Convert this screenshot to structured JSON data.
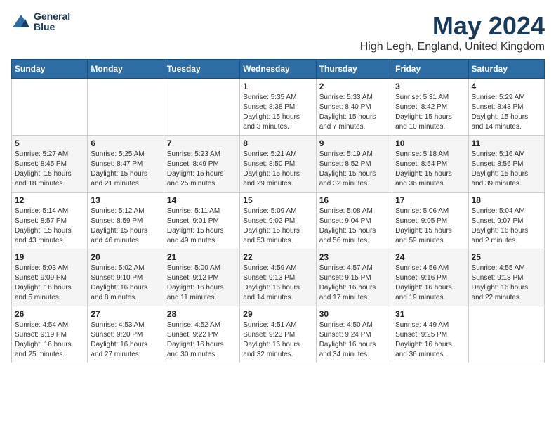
{
  "logo": {
    "line1": "General",
    "line2": "Blue"
  },
  "title": "May 2024",
  "subtitle": "High Legh, England, United Kingdom",
  "weekdays": [
    "Sunday",
    "Monday",
    "Tuesday",
    "Wednesday",
    "Thursday",
    "Friday",
    "Saturday"
  ],
  "weeks": [
    [
      {
        "day": "",
        "info": ""
      },
      {
        "day": "",
        "info": ""
      },
      {
        "day": "",
        "info": ""
      },
      {
        "day": "1",
        "info": "Sunrise: 5:35 AM\nSunset: 8:38 PM\nDaylight: 15 hours\nand 3 minutes."
      },
      {
        "day": "2",
        "info": "Sunrise: 5:33 AM\nSunset: 8:40 PM\nDaylight: 15 hours\nand 7 minutes."
      },
      {
        "day": "3",
        "info": "Sunrise: 5:31 AM\nSunset: 8:42 PM\nDaylight: 15 hours\nand 10 minutes."
      },
      {
        "day": "4",
        "info": "Sunrise: 5:29 AM\nSunset: 8:43 PM\nDaylight: 15 hours\nand 14 minutes."
      }
    ],
    [
      {
        "day": "5",
        "info": "Sunrise: 5:27 AM\nSunset: 8:45 PM\nDaylight: 15 hours\nand 18 minutes."
      },
      {
        "day": "6",
        "info": "Sunrise: 5:25 AM\nSunset: 8:47 PM\nDaylight: 15 hours\nand 21 minutes."
      },
      {
        "day": "7",
        "info": "Sunrise: 5:23 AM\nSunset: 8:49 PM\nDaylight: 15 hours\nand 25 minutes."
      },
      {
        "day": "8",
        "info": "Sunrise: 5:21 AM\nSunset: 8:50 PM\nDaylight: 15 hours\nand 29 minutes."
      },
      {
        "day": "9",
        "info": "Sunrise: 5:19 AM\nSunset: 8:52 PM\nDaylight: 15 hours\nand 32 minutes."
      },
      {
        "day": "10",
        "info": "Sunrise: 5:18 AM\nSunset: 8:54 PM\nDaylight: 15 hours\nand 36 minutes."
      },
      {
        "day": "11",
        "info": "Sunrise: 5:16 AM\nSunset: 8:56 PM\nDaylight: 15 hours\nand 39 minutes."
      }
    ],
    [
      {
        "day": "12",
        "info": "Sunrise: 5:14 AM\nSunset: 8:57 PM\nDaylight: 15 hours\nand 43 minutes."
      },
      {
        "day": "13",
        "info": "Sunrise: 5:12 AM\nSunset: 8:59 PM\nDaylight: 15 hours\nand 46 minutes."
      },
      {
        "day": "14",
        "info": "Sunrise: 5:11 AM\nSunset: 9:01 PM\nDaylight: 15 hours\nand 49 minutes."
      },
      {
        "day": "15",
        "info": "Sunrise: 5:09 AM\nSunset: 9:02 PM\nDaylight: 15 hours\nand 53 minutes."
      },
      {
        "day": "16",
        "info": "Sunrise: 5:08 AM\nSunset: 9:04 PM\nDaylight: 15 hours\nand 56 minutes."
      },
      {
        "day": "17",
        "info": "Sunrise: 5:06 AM\nSunset: 9:05 PM\nDaylight: 15 hours\nand 59 minutes."
      },
      {
        "day": "18",
        "info": "Sunrise: 5:04 AM\nSunset: 9:07 PM\nDaylight: 16 hours\nand 2 minutes."
      }
    ],
    [
      {
        "day": "19",
        "info": "Sunrise: 5:03 AM\nSunset: 9:09 PM\nDaylight: 16 hours\nand 5 minutes."
      },
      {
        "day": "20",
        "info": "Sunrise: 5:02 AM\nSunset: 9:10 PM\nDaylight: 16 hours\nand 8 minutes."
      },
      {
        "day": "21",
        "info": "Sunrise: 5:00 AM\nSunset: 9:12 PM\nDaylight: 16 hours\nand 11 minutes."
      },
      {
        "day": "22",
        "info": "Sunrise: 4:59 AM\nSunset: 9:13 PM\nDaylight: 16 hours\nand 14 minutes."
      },
      {
        "day": "23",
        "info": "Sunrise: 4:57 AM\nSunset: 9:15 PM\nDaylight: 16 hours\nand 17 minutes."
      },
      {
        "day": "24",
        "info": "Sunrise: 4:56 AM\nSunset: 9:16 PM\nDaylight: 16 hours\nand 19 minutes."
      },
      {
        "day": "25",
        "info": "Sunrise: 4:55 AM\nSunset: 9:18 PM\nDaylight: 16 hours\nand 22 minutes."
      }
    ],
    [
      {
        "day": "26",
        "info": "Sunrise: 4:54 AM\nSunset: 9:19 PM\nDaylight: 16 hours\nand 25 minutes."
      },
      {
        "day": "27",
        "info": "Sunrise: 4:53 AM\nSunset: 9:20 PM\nDaylight: 16 hours\nand 27 minutes."
      },
      {
        "day": "28",
        "info": "Sunrise: 4:52 AM\nSunset: 9:22 PM\nDaylight: 16 hours\nand 30 minutes."
      },
      {
        "day": "29",
        "info": "Sunrise: 4:51 AM\nSunset: 9:23 PM\nDaylight: 16 hours\nand 32 minutes."
      },
      {
        "day": "30",
        "info": "Sunrise: 4:50 AM\nSunset: 9:24 PM\nDaylight: 16 hours\nand 34 minutes."
      },
      {
        "day": "31",
        "info": "Sunrise: 4:49 AM\nSunset: 9:25 PM\nDaylight: 16 hours\nand 36 minutes."
      },
      {
        "day": "",
        "info": ""
      }
    ]
  ]
}
